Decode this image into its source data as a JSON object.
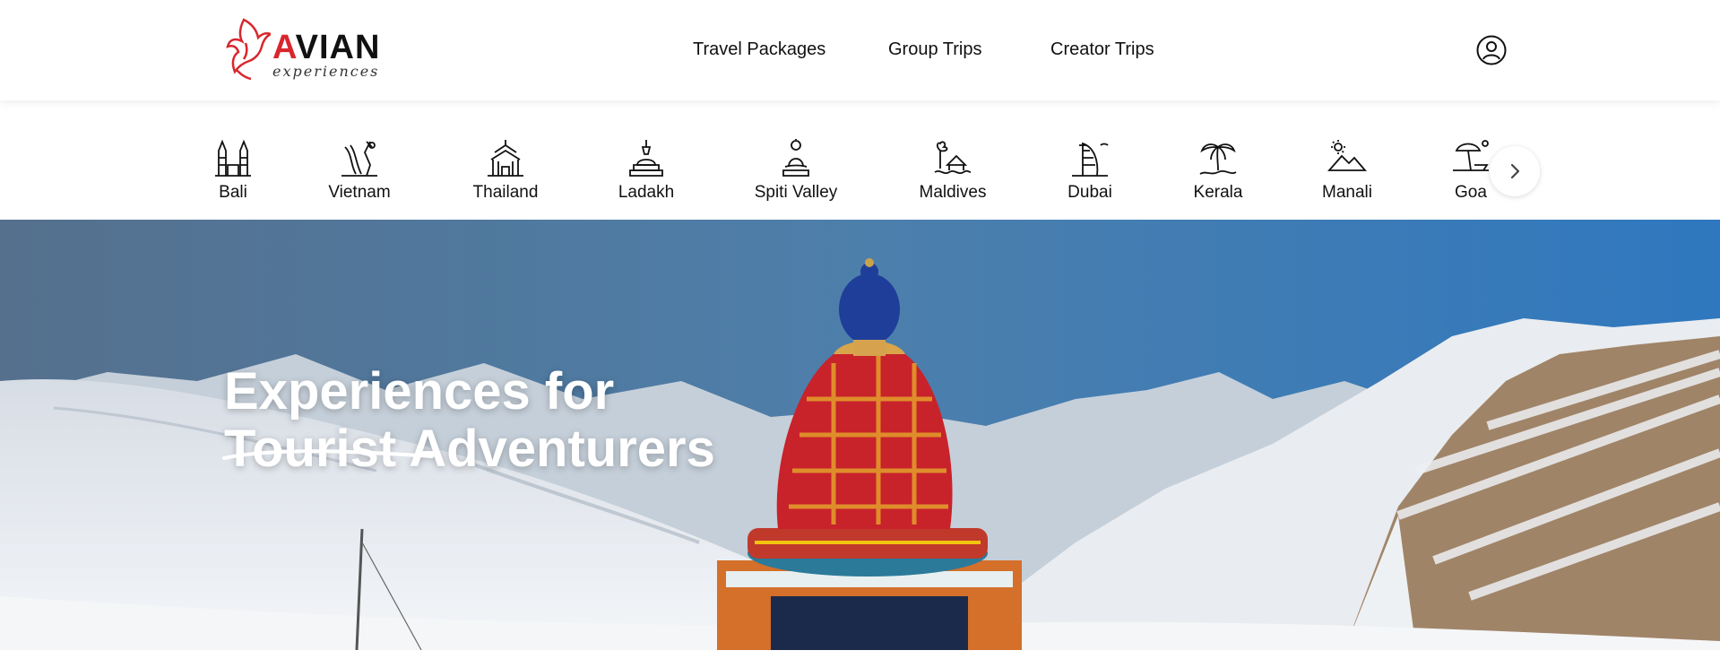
{
  "brand": {
    "name_a": "A",
    "name_rest": "VIAN",
    "tagline": "experiences",
    "accent": "#d8262d"
  },
  "nav": {
    "items": [
      {
        "label": "Travel Packages"
      },
      {
        "label": "Group Trips"
      },
      {
        "label": "Creator Trips"
      }
    ],
    "user_icon": "user-account-icon"
  },
  "destinations": [
    {
      "label": "Bali",
      "icon": "temple-gate-icon"
    },
    {
      "label": "Vietnam",
      "icon": "vietnam-landmark-icon"
    },
    {
      "label": "Thailand",
      "icon": "thai-temple-icon"
    },
    {
      "label": "Ladakh",
      "icon": "stupa-icon"
    },
    {
      "label": "Spiti Valley",
      "icon": "buddha-statue-icon"
    },
    {
      "label": "Maldives",
      "icon": "water-villa-icon"
    },
    {
      "label": "Dubai",
      "icon": "burj-al-arab-icon"
    },
    {
      "label": "Kerala",
      "icon": "palm-tree-icon"
    },
    {
      "label": "Manali",
      "icon": "mountain-sun-icon"
    },
    {
      "label": "Goa",
      "icon": "beach-umbrella-icon"
    }
  ],
  "carousel_next_icon": "chevron-right-icon",
  "hero": {
    "title_line1": "Experiences for",
    "struck_word": "Tourist",
    "title_word": "Adventurers"
  }
}
